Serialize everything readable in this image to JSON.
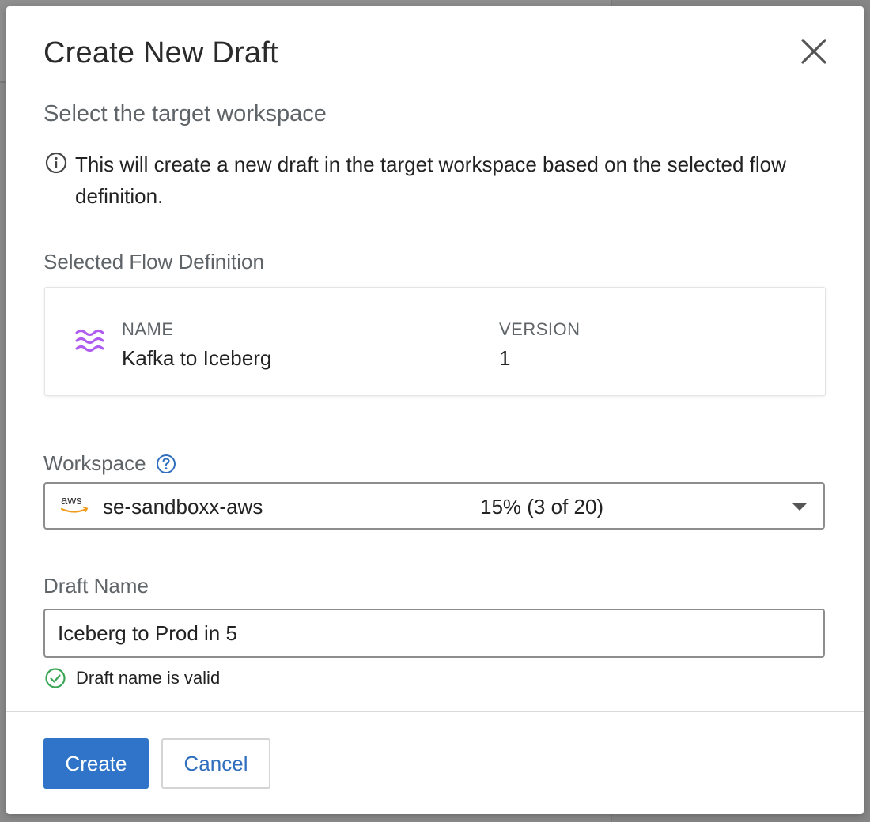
{
  "modal": {
    "title": "Create New Draft",
    "close_icon": "close-icon"
  },
  "target": {
    "heading": "Select the target workspace",
    "info_icon": "info-icon",
    "info_text": "This will create a new draft in the target workspace based on the selected flow definition."
  },
  "flow_definition": {
    "label": "Selected Flow Definition",
    "icon": "waves-icon",
    "icon_color": "#b05cf0",
    "name_label": "NAME",
    "name_value": "Kafka to Iceberg",
    "version_label": "VERSION",
    "version_value": "1"
  },
  "workspace": {
    "label": "Workspace",
    "help_icon": "question-circle-icon",
    "provider_logo": "aws-logo",
    "provider_text": "aws",
    "selected_value": "se-sandboxx-aws",
    "usage": "15% (3 of 20)"
  },
  "draft_name": {
    "label": "Draft Name",
    "value": "Iceberg to Prod in 5",
    "validation_icon": "check-circle-icon",
    "validation_text": "Draft name is valid",
    "validation_color": "#3aa655"
  },
  "footer": {
    "create_label": "Create",
    "cancel_label": "Cancel",
    "primary_color": "#2f74c8"
  }
}
